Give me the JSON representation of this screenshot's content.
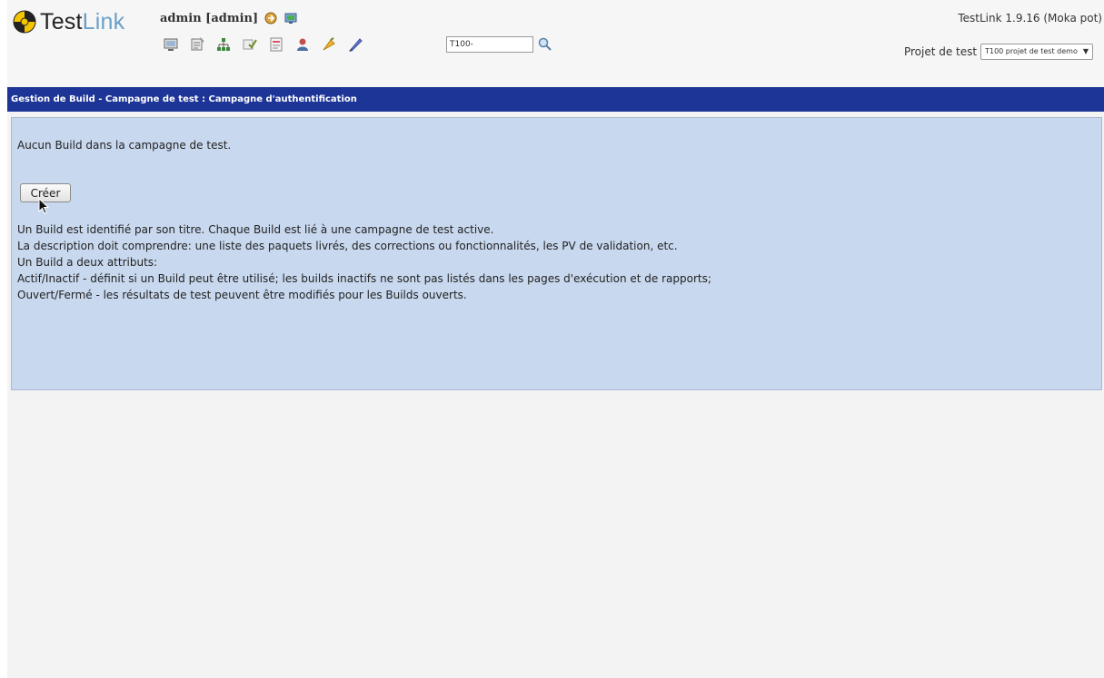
{
  "header": {
    "logo": {
      "part1": "Test",
      "part2": "Link"
    },
    "user": "admin [admin]",
    "version": "TestLink 1.9.16 (Moka pot)",
    "testcase_search": {
      "value": "T100-"
    },
    "project": {
      "label": "Projet de test",
      "selected": "T100 projet de test demo"
    },
    "icons": {
      "user": [
        "logout-icon",
        "user-settings-icon"
      ],
      "toolbar": [
        "desktop-icon",
        "requirements-icon",
        "test-specification-icon",
        "test-execution-icon",
        "test-reports-icon",
        "user-management-icon",
        "events-icon",
        "custom-fields-icon"
      ],
      "search": "search-icon"
    }
  },
  "titlebar": {
    "text": "Gestion de Build - Campagne de test : Campagne d'authentification"
  },
  "content": {
    "empty_message": "Aucun Build dans la campagne de test.",
    "create_button": "Créer",
    "help_lines": [
      "Un Build est identifié par son titre. Chaque Build est lié à une campagne de test active.",
      "La description doit comprendre: une liste des paquets livrés, des corrections ou fonctionnalités, les PV de validation, etc.",
      "Un Build a deux attributs:",
      "Actif/Inactif - définit si un Build peut être utilisé; les builds inactifs ne sont pas listés dans les pages d'exécution et de rapports;",
      "Ouvert/Fermé - les résultats de test peuvent être modifiés pour les Builds ouverts."
    ]
  },
  "colors": {
    "titlebar": "#1d3596",
    "panel": "#c8d8ee",
    "background": "#f3f3f3"
  }
}
